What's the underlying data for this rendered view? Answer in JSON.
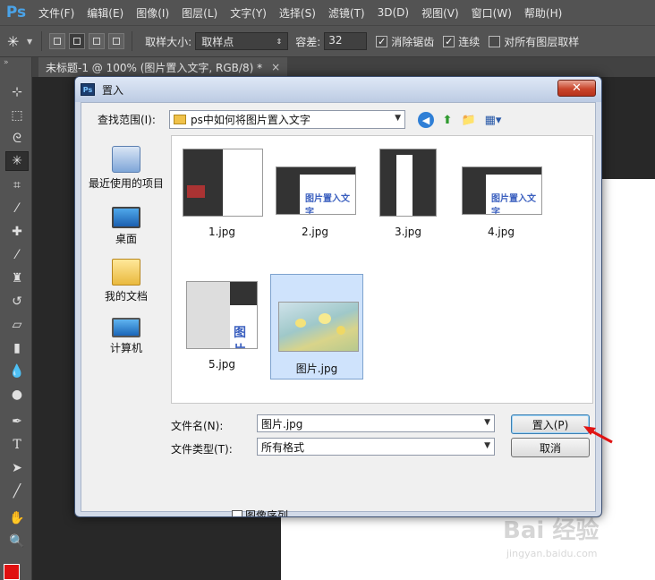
{
  "app": {
    "logo": "Ps",
    "menu": [
      "文件(F)",
      "编辑(E)",
      "图像(I)",
      "图层(L)",
      "文字(Y)",
      "选择(S)",
      "滤镜(T)",
      "3D(D)",
      "视图(V)",
      "窗口(W)",
      "帮助(H)"
    ]
  },
  "options_bar": {
    "sample_size_label": "取样大小:",
    "sample_size_value": "取样点",
    "tolerance_label": "容差:",
    "tolerance_value": "32",
    "antialias_label": "消除锯齿",
    "antialias_checked": true,
    "contiguous_label": "连续",
    "contiguous_checked": true,
    "all_layers_label": "对所有图层取样",
    "all_layers_checked": false
  },
  "document": {
    "tab_title": "未标题-1 @ 100% (图片置入文字, RGB/8) *",
    "tab_close": "×"
  },
  "dialog": {
    "title": "置入",
    "close_glyph": "✕",
    "look_in_label": "查找范围(I):",
    "look_in_value": "ps中如何将图片置入文字",
    "places": [
      {
        "label": "最近使用的项目"
      },
      {
        "label": "桌面"
      },
      {
        "label": "我的文档"
      },
      {
        "label": "计算机"
      }
    ],
    "files": [
      {
        "name": "1.jpg"
      },
      {
        "name": "2.jpg",
        "thumb_text": "图片置入文字"
      },
      {
        "name": "3.jpg"
      },
      {
        "name": "4.jpg",
        "thumb_text": "图片置入文字"
      },
      {
        "name": "5.jpg",
        "thumb_text": "图片"
      },
      {
        "name": "图片.jpg",
        "selected": true
      }
    ],
    "file_name_label": "文件名(N):",
    "file_name_value": "图片.jpg",
    "file_type_label": "文件类型(T):",
    "file_type_value": "所有格式",
    "place_button": "置入(P)",
    "cancel_button": "取消",
    "image_sequence_label": "图像序列",
    "image_sequence_checked": false
  },
  "watermark": {
    "text": "Bai  经验",
    "sub": "jingyan.baidu.com"
  },
  "colors": {
    "ps_bg": "#535353",
    "accent_blue": "#4b7bd8",
    "foreground": "#e01010"
  }
}
